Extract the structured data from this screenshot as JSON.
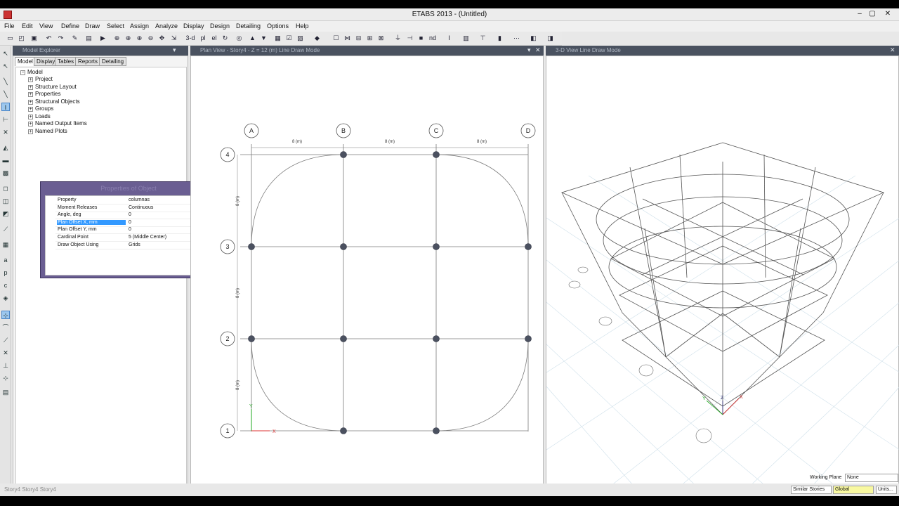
{
  "app": {
    "title": "ETABS 2013 - (Untitled)",
    "window_controls": [
      "–",
      "▢",
      "✕"
    ]
  },
  "menu": [
    "File",
    "Edit",
    "View",
    "Define",
    "Draw",
    "Select",
    "Assign",
    "Analyze",
    "Display",
    "Design",
    "Detailing",
    "Options",
    "Help"
  ],
  "toolbar": {
    "view_3d_label": "3-d",
    "view_plan_label": "pl",
    "view_elev_label": "el",
    "nd_label": "nd"
  },
  "explorer": {
    "header": "Model Explorer",
    "tabs": [
      "Model",
      "Display",
      "Tables",
      "Reports",
      "Detailing"
    ],
    "root": "Model",
    "items": [
      "Project",
      "Structure Layout",
      "Properties",
      "Structural Objects",
      "Groups",
      "Loads",
      "Named Output Items",
      "Named Plots"
    ]
  },
  "properties_dialog": {
    "title": "Properties of Object",
    "rows": [
      {
        "key": "Property",
        "value": "columnas"
      },
      {
        "key": "Moment Releases",
        "value": "Continuous"
      },
      {
        "key": "Angle, deg",
        "value": "0"
      },
      {
        "key": "Plan Offset X, mm",
        "value": "0"
      },
      {
        "key": "Plan Offset Y, mm",
        "value": "0"
      },
      {
        "key": "Cardinal Point",
        "value": "5 (Middle Center)"
      },
      {
        "key": "Draw Object Using",
        "value": "Grids"
      }
    ],
    "selected_row": "Plan Offset X, mm"
  },
  "plan_view": {
    "header": "Plan View - Story4 - Z = 12 (m) Line Draw Mode",
    "grid_x_labels": [
      "A",
      "B",
      "C",
      "D"
    ],
    "grid_y_labels": [
      "4",
      "3",
      "2",
      "1"
    ],
    "x_spacing_label": "8 (m)",
    "y_spacing_label": "8 (m)",
    "axis_x": "X",
    "axis_y": "Y"
  },
  "view_3d": {
    "header": "3-D View Line Draw Mode",
    "axis_x": "X",
    "axis_y": "Y",
    "axis_z": "Z"
  },
  "statusbar": {
    "left_text": "Story4 Story4 Story4",
    "working_plane_label": "Working Plane",
    "working_plane_value": "None",
    "similar_stories": "Similar Stories",
    "coord_system": "Global",
    "units_button": "Units..."
  }
}
